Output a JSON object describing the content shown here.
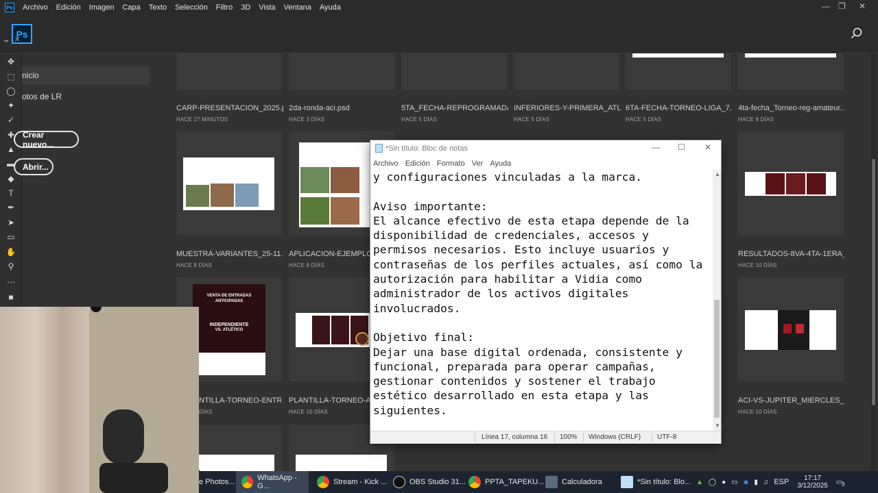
{
  "photoshop": {
    "logo": "Ps",
    "menu": [
      "Archivo",
      "Edición",
      "Imagen",
      "Capa",
      "Texto",
      "Selección",
      "Filtro",
      "3D",
      "Vista",
      "Ventana",
      "Ayuda"
    ],
    "nav": {
      "home": "nicio",
      "lr_photos": "otos de LR"
    },
    "create_new": "Crear nuevo...",
    "open": "Abrir...",
    "accent": "#31a8ff"
  },
  "files": [
    {
      "name": "CARP-PRESENTACION_2025.psd",
      "date": "HACE 27 MINUTOS"
    },
    {
      "name": "2da-ronda-aci.psd",
      "date": "HACE 3 DÍAS"
    },
    {
      "name": "5TA_FECHA-REPROGRAMADA...",
      "date": "HACE 5 DÍAS"
    },
    {
      "name": "INFERIORES-Y-PRIMERA_ATLE...",
      "date": "HACE 5 DÍAS"
    },
    {
      "name": "6TA-FECHA-TORNEO-LIGA_7...",
      "date": "HACE 5 DÍAS"
    },
    {
      "name": "4ta-fecha_Torneo-reg-amateur...",
      "date": "HACE 8 DÍAS"
    },
    {
      "name": "MUESTRA-VARIANTES_25-11.psd",
      "date": "HACE 8 DÍAS"
    },
    {
      "name": "APLICACION-EJEMPLO.ps",
      "date": "HACE 8 DÍAS"
    },
    {
      "name": "RESULTADOS-8VA-4TA-1ERA_T...",
      "date": "HACE 10 DÍAS"
    },
    {
      "name": "NTILLA-TORNEO-ENTRAD...",
      "date": "DÍAS"
    },
    {
      "name": "PLANTILLA-TORNEO-ACI...",
      "date": "HACE 10 DÍAS"
    },
    {
      "name": "ACI-VS-JUPITER_MIERCLES_15...",
      "date": "HACE 10 DÍAS"
    }
  ],
  "poster": {
    "line1": "VENTA DE ENTRADAS",
    "line2": "ANTICIPADAS",
    "team1": "INDEPENDIENTE",
    "team2": "VS. ATLÉTICO"
  },
  "notepad": {
    "title": "*Sin título: Bloc de notas",
    "menu": [
      "Archivo",
      "Edición",
      "Formato",
      "Ver",
      "Ayuda"
    ],
    "text": "y configuraciones vinculadas a la marca.\n\nAviso importante:\nEl alcance efectivo de esta etapa depende de la\ndisponibilidad de credenciales, accesos y\npermisos necesarios. Esto incluye usuarios y\ncontraseñas de los perfiles actuales, así como la\nautorización para habilitar a Vidia como\nadministrador de los activos digitales\ninvolucrados.\n\nObjetivo final:\nDejar una base digital ordenada, consistente y\nfuncional, preparada para operar campañas,\ngestionar contenidos y sostener el trabajo\nestético desarrollado en esta etapa y las\nsiguientes.",
    "status": {
      "position": "Línea 17, columna 16",
      "zoom": "100%",
      "eol": "Windows (CRLF)",
      "encoding": "UTF-8"
    }
  },
  "taskbar": {
    "apps": [
      {
        "label": "e Photos...",
        "icon": "photos-icon"
      },
      {
        "label": "WhatsApp - G...",
        "icon": "chrome-icon"
      },
      {
        "label": "Stream - Kick ...",
        "icon": "chrome-icon"
      },
      {
        "label": "OBS Studio 31...",
        "icon": "obs-icon"
      },
      {
        "label": "PPTA_TAPEKU...",
        "icon": "chrome-icon"
      },
      {
        "label": "Calculadora",
        "icon": "calculator-icon"
      },
      {
        "label": "*Sin título: Blo...",
        "icon": "notepad-icon"
      }
    ],
    "lang": "ESP",
    "time": "17:17",
    "date": "3/12/2025",
    "notifications": "3"
  }
}
